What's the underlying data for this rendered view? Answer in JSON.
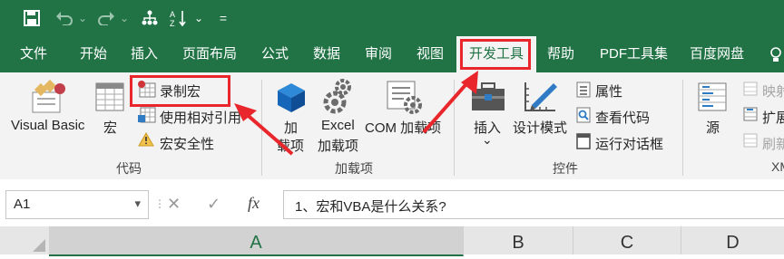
{
  "qat": {
    "save_icon": "save-icon",
    "undo_icon": "undo-icon",
    "redo_icon": "redo-icon",
    "dropdown_glyph": "⌄",
    "customize_glyph": "=",
    "sort_icon": "sort-az-icon"
  },
  "tabs": [
    "文件",
    "开始",
    "插入",
    "页面布局",
    "公式",
    "数据",
    "审阅",
    "视图",
    "开发工具",
    "帮助",
    "PDF工具集",
    "百度网盘"
  ],
  "active_tab": "开发工具",
  "ribbon": {
    "code": {
      "visual_basic": "Visual Basic",
      "macros": "宏",
      "record_macro": "录制宏",
      "use_relative": "使用相对引用",
      "macro_security": "宏安全性",
      "group_label": "代码"
    },
    "addins": {
      "addins_line1": "加",
      "addins_line2": "载项",
      "excel_line1": "Excel",
      "excel_line2": "加载项",
      "com": "COM 加载项",
      "group_label": "加载项"
    },
    "controls": {
      "insert": "插入",
      "insert_arrow": "⌄",
      "design_mode": "设计模式",
      "properties": "属性",
      "view_code": "查看代码",
      "run_dialog": "运行对话框",
      "group_label": "控件"
    },
    "xml": {
      "source": "源",
      "map_props": "映射",
      "expansion": "扩展",
      "refresh": "刷新",
      "group_label": "XM"
    }
  },
  "formula_bar": {
    "name_box": "A1",
    "name_arrow": "▾",
    "cancel": "✕",
    "enter": "✓",
    "fx": "fx",
    "formula": "1、宏和VBA是什么关系?"
  },
  "columns": [
    "A",
    "B",
    "C",
    "D"
  ],
  "colors": {
    "excel_green": "#217346",
    "ribbon_bg": "#f3f3f3",
    "annotation_red": "#e8262b"
  }
}
